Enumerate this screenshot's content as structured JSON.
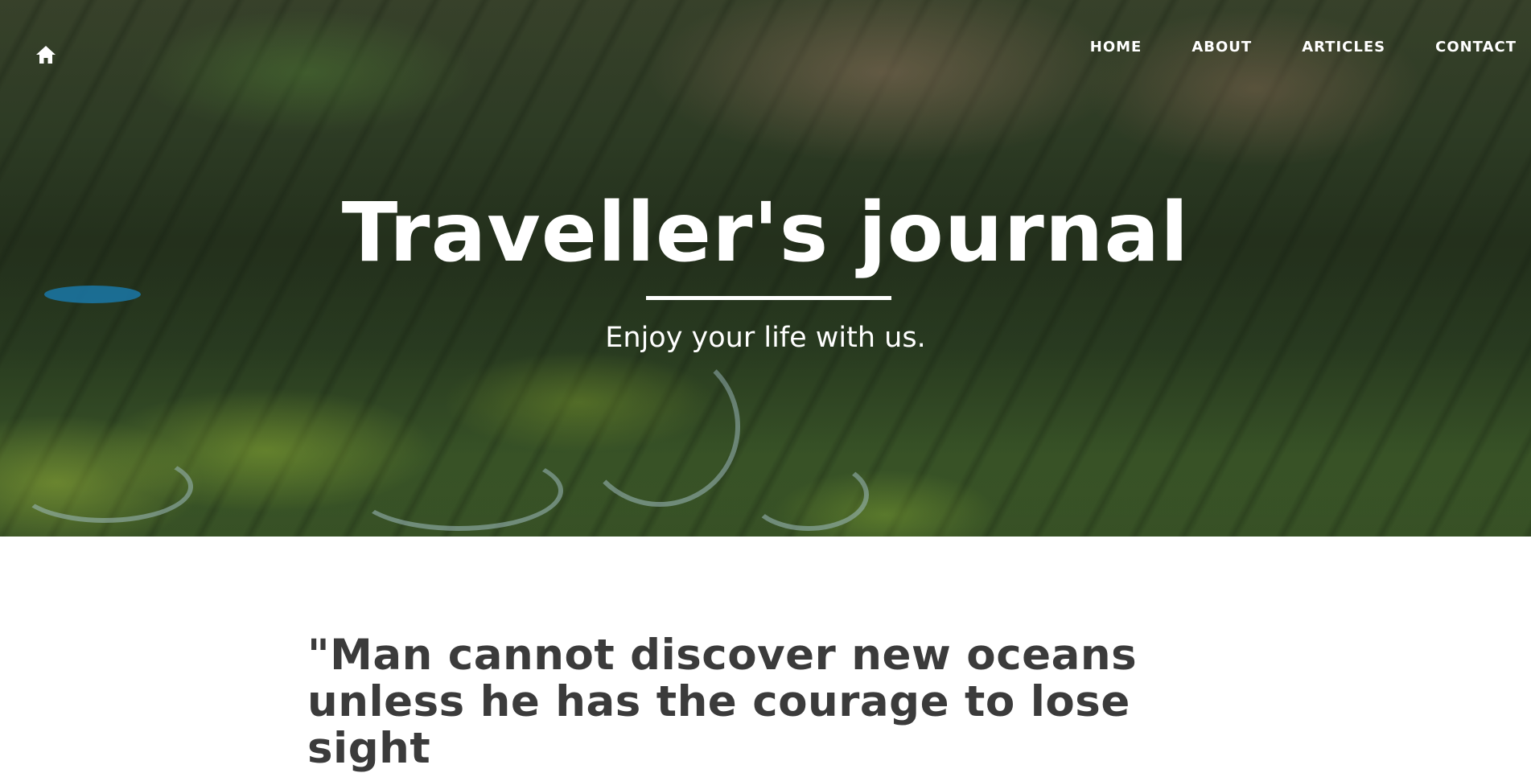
{
  "nav": {
    "home_icon": "home-icon",
    "links": [
      {
        "label": "HOME"
      },
      {
        "label": "ABOUT"
      },
      {
        "label": "ARTICLES"
      },
      {
        "label": "CONTACT"
      }
    ]
  },
  "hero": {
    "title": "Traveller's journal",
    "subtitle": "Enjoy your life with us.",
    "background": "mountain-valley-aerial-photo"
  },
  "quote": {
    "text": "\"Man cannot discover new oceans unless he has the courage to lose sight"
  },
  "colors": {
    "hero_text": "#ffffff",
    "quote_text": "#3b3b3b",
    "page_background": "#ffffff"
  }
}
